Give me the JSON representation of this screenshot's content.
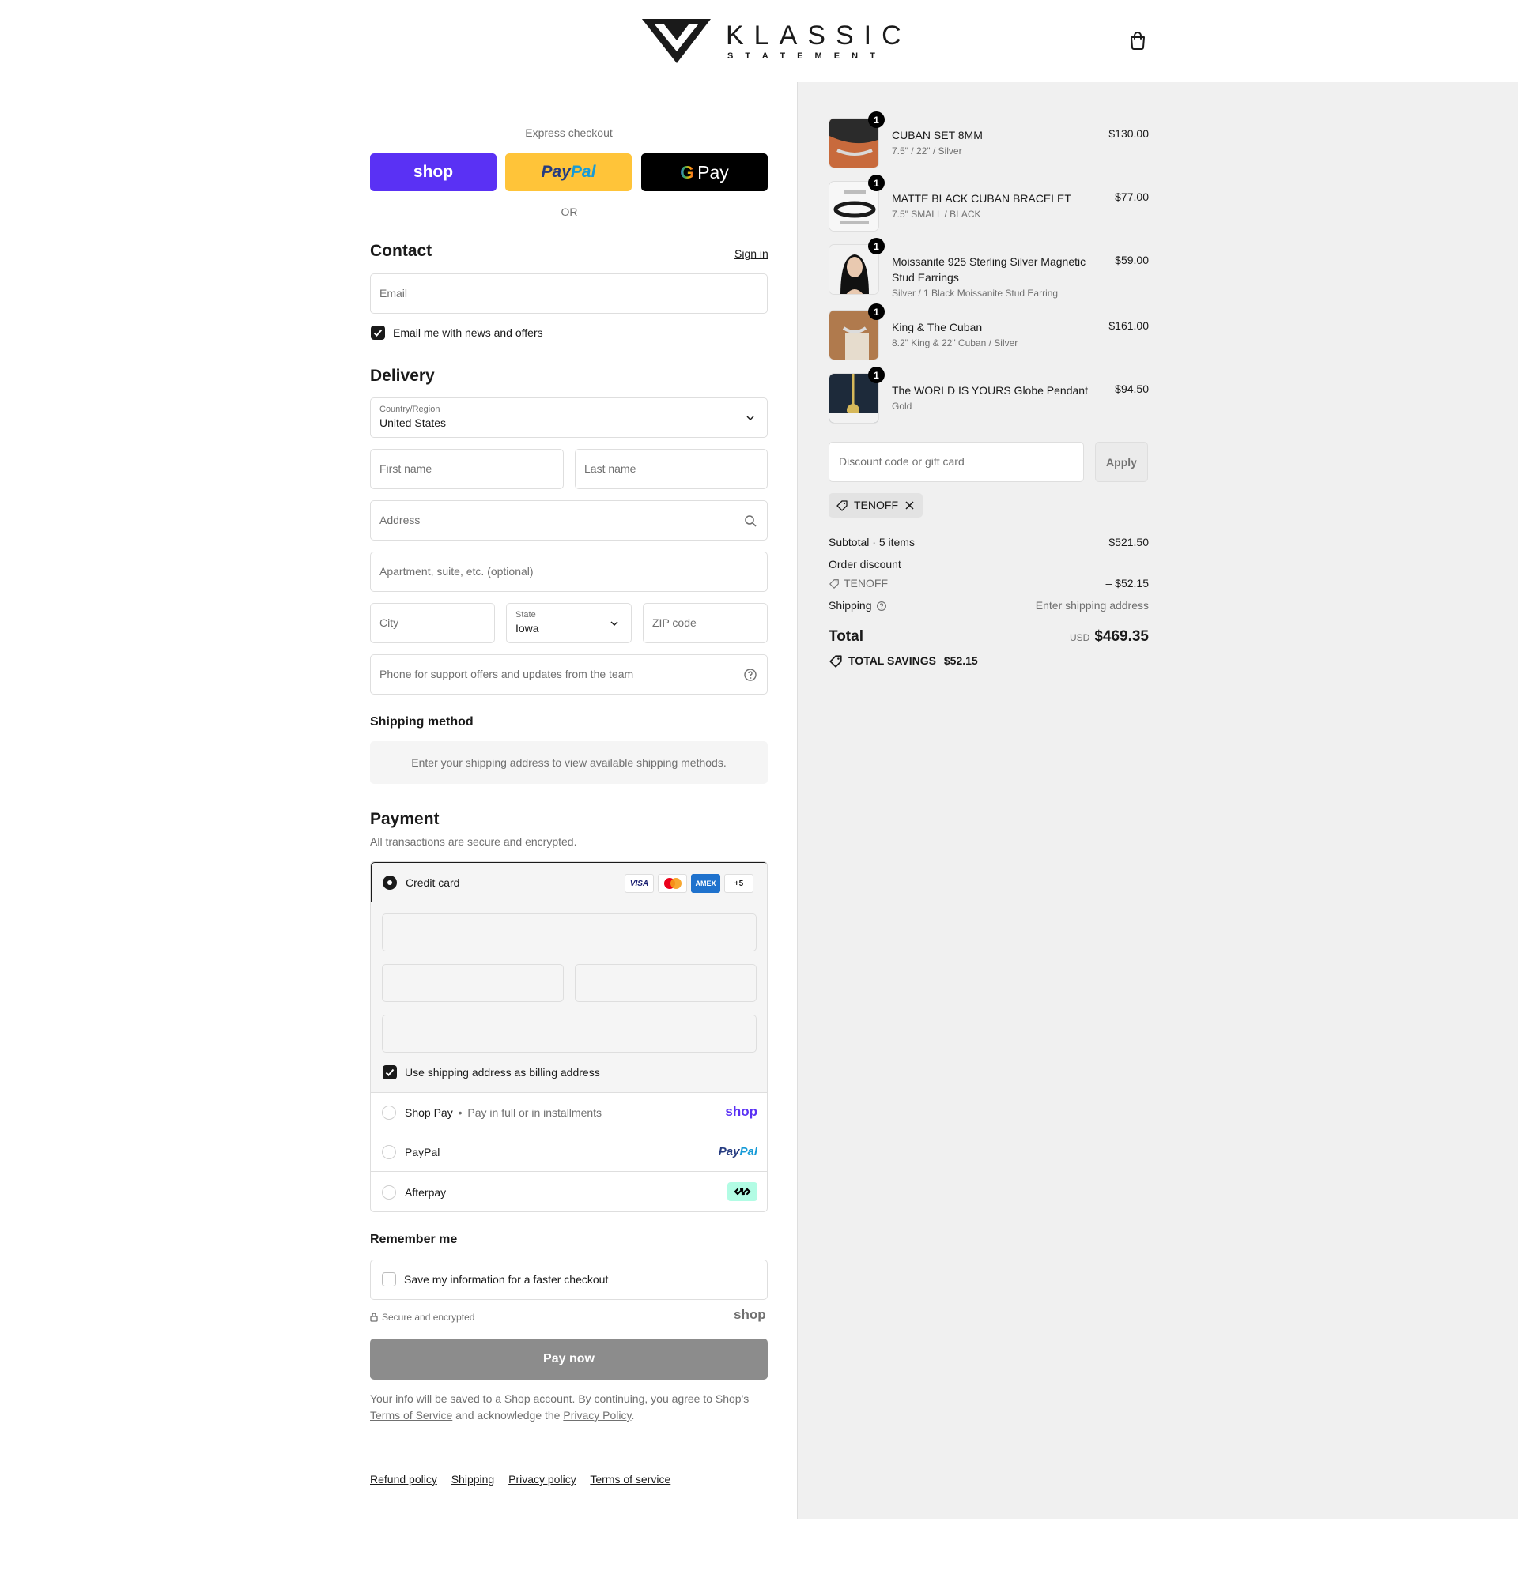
{
  "brand": {
    "name": "KLASSIC",
    "tagline": "S T A T E M E N T"
  },
  "express": {
    "label": "Express checkout",
    "shop_label": "shop",
    "paypal_label_a": "Pay",
    "paypal_label_b": "Pal",
    "gpay_label": "Pay",
    "or_label": "OR"
  },
  "contact": {
    "title": "Contact",
    "sign_in": "Sign in",
    "email_placeholder": "Email",
    "newsletter_label": "Email me with news and offers",
    "newsletter_checked": true
  },
  "delivery": {
    "title": "Delivery",
    "country_label": "Country/Region",
    "country_value": "United States",
    "first_name_placeholder": "First name",
    "last_name_placeholder": "Last name",
    "address_placeholder": "Address",
    "apartment_placeholder": "Apartment, suite, etc. (optional)",
    "city_placeholder": "City",
    "state_label": "State",
    "state_value": "Iowa",
    "zip_placeholder": "ZIP code",
    "phone_placeholder": "Phone for support offers and updates from the team"
  },
  "shipping_method": {
    "title": "Shipping method",
    "note": "Enter your shipping address to view available shipping methods."
  },
  "payment": {
    "title": "Payment",
    "subtitle": "All transactions are secure and encrypted.",
    "credit_card_label": "Credit card",
    "card_logos": [
      "VISA",
      "MC",
      "AMEX",
      "+5"
    ],
    "billing_label": "Use shipping address as billing address",
    "shop_pay_label": "Shop Pay",
    "shop_pay_sub": "Pay in full or in installments",
    "shop_pay_logo": "shop",
    "paypal_label": "PayPal",
    "paypal_logo_a": "Pay",
    "paypal_logo_b": "Pal",
    "afterpay_label": "Afterpay"
  },
  "remember": {
    "title": "Remember me",
    "save_label": "Save my information for a faster checkout",
    "secure_label": "Secure and encrypted",
    "shop_logo": "shop"
  },
  "pay_now": "Pay now",
  "legal": {
    "text_a": "Your info will be saved to a Shop account. By continuing, you agree to Shop's",
    "terms": "Terms of Service",
    "text_b": "and acknowledge the",
    "privacy": "Privacy Policy",
    "text_c": "."
  },
  "footer_links": [
    "Refund policy",
    "Shipping",
    "Privacy policy",
    "Terms of service"
  ],
  "cart": {
    "items": [
      {
        "name": "CUBAN SET 8MM",
        "variant": "7.5\" / 22\" / Silver",
        "price": "$130.00",
        "qty": "1"
      },
      {
        "name": "MATTE BLACK CUBAN BRACELET",
        "variant": "7.5\" SMALL / BLACK",
        "price": "$77.00",
        "qty": "1"
      },
      {
        "name": "Moissanite 925 Sterling Silver Magnetic Stud Earrings",
        "variant": "Silver / 1 Black Moissanite Stud Earring",
        "price": "$59.00",
        "qty": "1"
      },
      {
        "name": "King & The Cuban",
        "variant": "8.2\" King & 22\" Cuban / Silver",
        "price": "$161.00",
        "qty": "1"
      },
      {
        "name": "The WORLD IS YOURS Globe Pendant",
        "variant": "Gold",
        "price": "$94.50",
        "qty": "1"
      }
    ],
    "discount_placeholder": "Discount code or gift card",
    "apply_label": "Apply",
    "applied_code": "TENOFF"
  },
  "totals": {
    "subtotal_label": "Subtotal · 5 items",
    "subtotal_value": "$521.50",
    "order_discount_label": "Order discount",
    "discount_code": "TENOFF",
    "discount_value": "– $52.15",
    "shipping_label": "Shipping",
    "shipping_value": "Enter shipping address",
    "total_label": "Total",
    "currency": "USD",
    "total_value": "$469.35",
    "savings_label": "TOTAL SAVINGS",
    "savings_value": "$52.15"
  },
  "colors": {
    "shop_purple": "#5a31f4",
    "paypal_yellow": "#ffc439",
    "afterpay_mint": "#b2fce4",
    "pay_now_disabled": "#8c8c8c"
  }
}
